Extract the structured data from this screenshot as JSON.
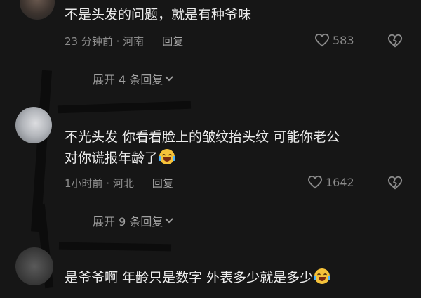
{
  "comments": [
    {
      "text": "不是头发的问题，就是有种爷味",
      "time": "23 分钟前 · 河南",
      "reply_label": "回复",
      "likes": "583",
      "expand_label": "展开 4 条回复"
    },
    {
      "text_line1": "不光头发 你看看脸上的皱纹抬头纹 可能你老公",
      "text_line2": "对你谎报年龄了",
      "emoji": "laughing-tears-emoji",
      "time": "1小时前 · 河北",
      "reply_label": "回复",
      "likes": "1642",
      "expand_label": "展开 9 条回复"
    },
    {
      "text": "是爷爷啊 年龄只是数字 外表多少就是多少",
      "emoji": "laughing-tears-emoji"
    }
  ],
  "colors": {
    "background": "#161616",
    "text": "#ececec",
    "meta": "#8c8c8c"
  }
}
